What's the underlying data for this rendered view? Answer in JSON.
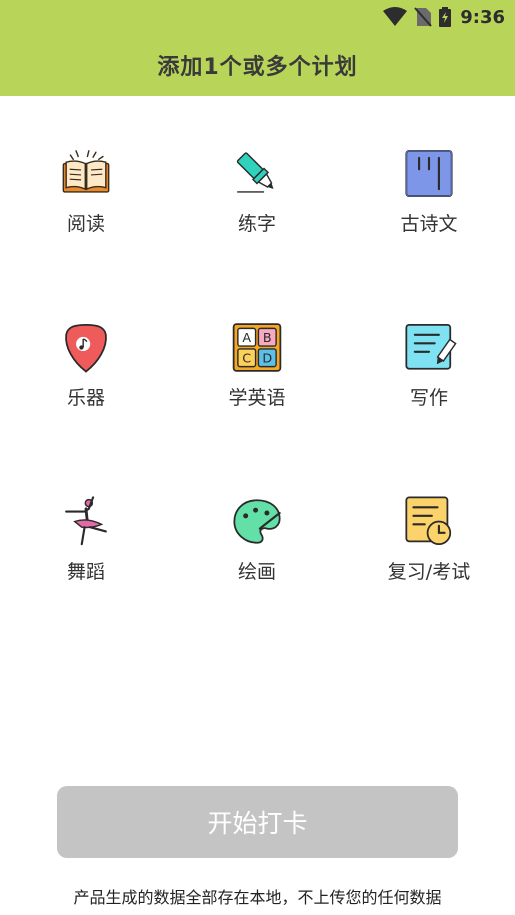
{
  "status_bar": {
    "time": "9:36",
    "icons": [
      "wifi-icon",
      "no-sim-icon",
      "battery-charging-icon"
    ]
  },
  "header": {
    "title": "添加1个或多个计划"
  },
  "plans": [
    {
      "label": "阅读",
      "icon": "book-icon"
    },
    {
      "label": "练字",
      "icon": "marker-pen-icon"
    },
    {
      "label": "古诗文",
      "icon": "scroll-icon"
    },
    {
      "label": "乐器",
      "icon": "guitar-pick-icon"
    },
    {
      "label": "学英语",
      "icon": "abcd-blocks-icon"
    },
    {
      "label": "写作",
      "icon": "notepad-pencil-icon"
    },
    {
      "label": "舞蹈",
      "icon": "ballet-dancer-icon"
    },
    {
      "label": "绘画",
      "icon": "paint-palette-icon"
    },
    {
      "label": "复习/考试",
      "icon": "document-clock-icon"
    }
  ],
  "start_button": {
    "label": "开始打卡"
  },
  "footer": {
    "note": "产品生成的数据全部存在本地，不上传您的任何数据"
  },
  "colors": {
    "header_bg": "#b8d55a",
    "button_disabled": "#c4c4c4"
  }
}
